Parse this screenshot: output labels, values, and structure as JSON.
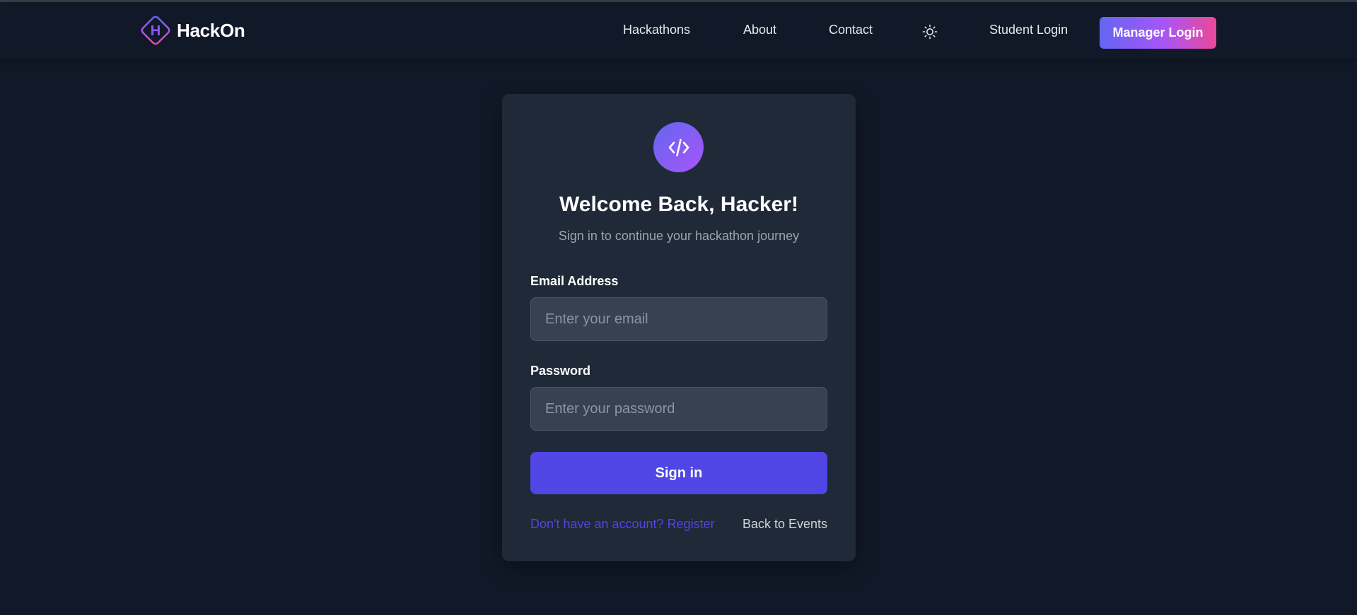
{
  "header": {
    "brand_letter": "H",
    "brand_name": "HackOn",
    "nav": {
      "hackathons": "Hackathons",
      "about": "About",
      "contact": "Contact",
      "student_login": "Student Login",
      "manager_login": "Manager Login"
    },
    "theme_icon": "sun-icon"
  },
  "login_card": {
    "icon": "code-icon",
    "title": "Welcome Back, Hacker!",
    "subtitle": "Sign in to continue your hackathon journey",
    "email": {
      "label": "Email Address",
      "placeholder": "Enter your email",
      "value": ""
    },
    "password": {
      "label": "Password",
      "placeholder": "Enter your password",
      "value": ""
    },
    "submit_label": "Sign in",
    "register_link": "Don't have an account? Register",
    "back_link": "Back to Events"
  },
  "colors": {
    "background": "#111827",
    "card": "#1f2937",
    "input": "#374151",
    "primary": "#4f46e5",
    "gradient_start": "#6366f1",
    "gradient_mid": "#a855f7",
    "gradient_end": "#ec4899"
  }
}
